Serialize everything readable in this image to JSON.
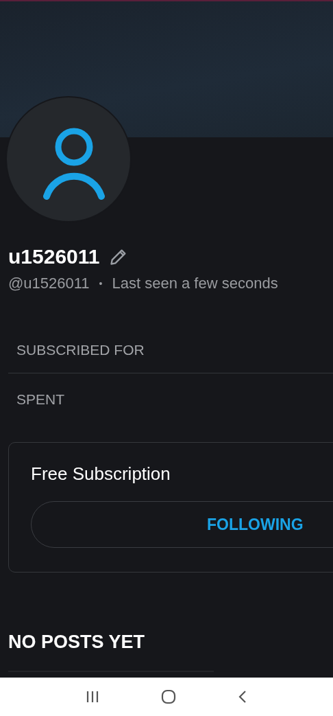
{
  "profile": {
    "name": "u1526011",
    "handle": "@u1526011",
    "separator": "•",
    "status": "Last seen a few seconds"
  },
  "stats": [
    {
      "label": "SUBSCRIBED FOR"
    },
    {
      "label": "SPENT"
    }
  ],
  "subscription": {
    "title": "Free Subscription",
    "button": "FOLLOWING"
  },
  "posts": {
    "heading": "NO POSTS YET"
  }
}
